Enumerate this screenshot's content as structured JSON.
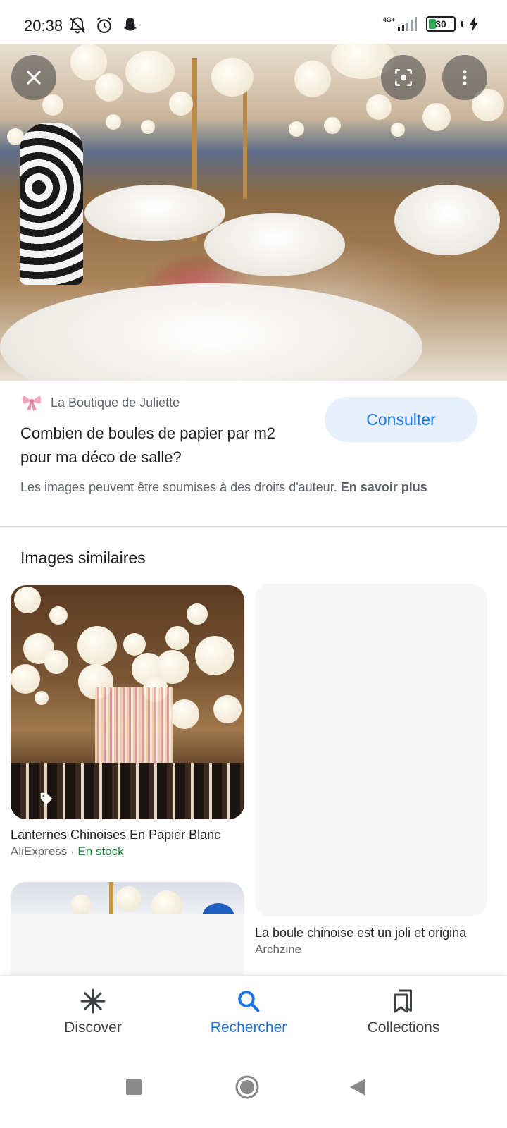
{
  "status_bar": {
    "time": "20:38",
    "network": "4G+",
    "battery": "30"
  },
  "hero": {
    "close_icon": "close-icon",
    "lens_icon": "lens-icon",
    "more_icon": "more-vert-icon"
  },
  "result": {
    "source_name": "La Boutique de Juliette",
    "title": "Combien de boules de papier par m2 pour ma déco de salle?",
    "visit_label": "Consulter",
    "copyright_text": "Les images peuvent être soumises à des droits d'auteur.",
    "learn_more": "En savoir plus"
  },
  "similar": {
    "heading": "Images similaires",
    "items": [
      {
        "title": "Lanternes Chinoises En Papier Blanc",
        "source": "AliExpress",
        "separator": " · ",
        "stock": "En stock"
      },
      {
        "title": "La boule chinoise est un joli et origina",
        "source": "Archzine"
      }
    ]
  },
  "bottom_nav": {
    "items": [
      {
        "label": "Discover",
        "icon": "asterisk-icon"
      },
      {
        "label": "Rechercher",
        "icon": "search-icon"
      },
      {
        "label": "Collections",
        "icon": "bookmarks-icon"
      }
    ]
  },
  "colors": {
    "accent": "#1a73e8",
    "stock_green": "#188038",
    "button_bg": "#e8f0fe"
  }
}
